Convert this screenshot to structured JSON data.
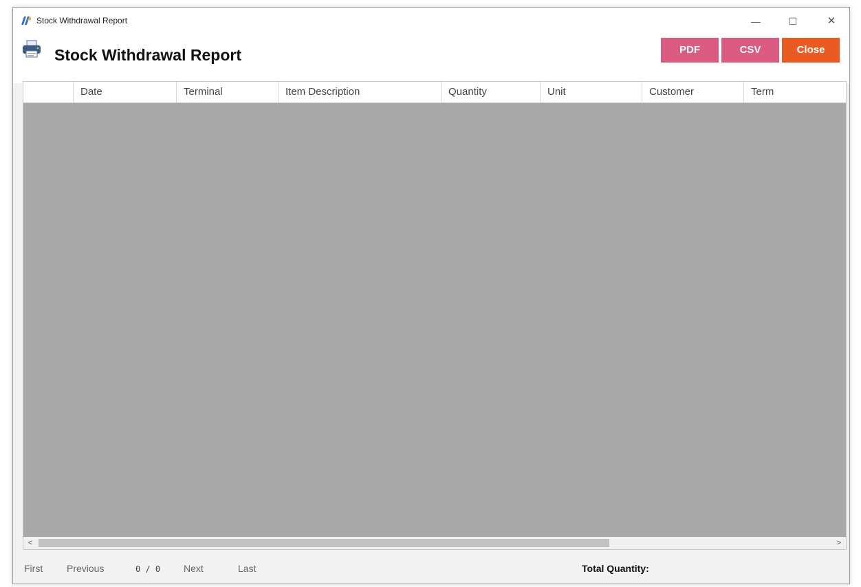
{
  "window": {
    "title": "Stock Withdrawal Report",
    "minimize_glyph": "—",
    "maximize_glyph": "☐",
    "close_glyph": "✕"
  },
  "header": {
    "title": "Stock Withdrawal Report",
    "icon": "printer-icon"
  },
  "toolbar": {
    "pdf_label": "PDF",
    "csv_label": "CSV",
    "close_label": "Close"
  },
  "grid": {
    "columns": [
      "",
      "Date",
      "Terminal",
      "Item Description",
      "Quantity",
      "Unit",
      "Customer",
      "Term"
    ],
    "rows": []
  },
  "scrollbar": {
    "left_glyph": "<",
    "right_glyph": ">"
  },
  "pager": {
    "first": "First",
    "previous": "Previous",
    "count": "0 / 0",
    "next": "Next",
    "last": "Last"
  },
  "totals": {
    "quantity_label": "Total Quantity:",
    "quantity_value": ""
  },
  "colors": {
    "pdf_button": "#dc5b82",
    "csv_button": "#dc5b82",
    "close_button": "#ea5b24",
    "grid_background": "#a9a9a9"
  }
}
